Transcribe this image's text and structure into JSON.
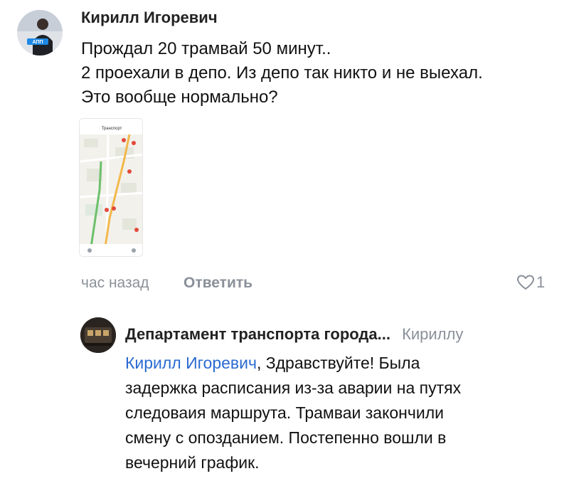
{
  "comment": {
    "author": "Кирилл Игоревич",
    "avatar_label": "АПП",
    "lines": [
      "Прождал 20 трамвай 50 минут..",
      "2 проехали в депо. Из депо так никто и не выехал.",
      "Это вообще нормально?"
    ],
    "attachment": {
      "type": "map-screenshot",
      "header_title": "Транспорт"
    },
    "time": "час назад",
    "reply_label": "Ответить",
    "likes": "1"
  },
  "reply": {
    "author": "Департамент транспорта города...",
    "to": "Кириллу",
    "mention": "Кирилл Игоревич",
    "first_line_rest": ", Здравствуйте! Была",
    "lines": [
      "задержка расписания из-за аварии на путях",
      "следоваия маршрута. Трамваи закончили",
      "смену с опозданием. Постепенно вошли в",
      "вечерний график."
    ]
  },
  "colors": {
    "link": "#2a6bd1",
    "meta": "#8a9099",
    "text": "#111111"
  },
  "icons": [
    "heart-icon"
  ]
}
